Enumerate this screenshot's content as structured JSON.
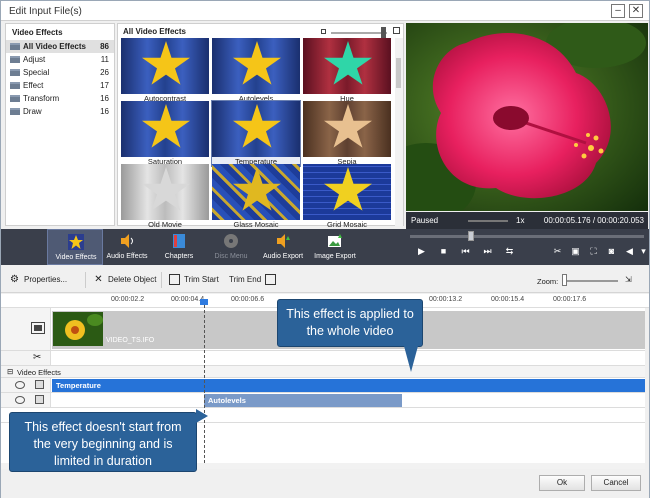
{
  "window": {
    "title": "Edit Input File(s)"
  },
  "categories": {
    "header": "Video Effects",
    "items": [
      {
        "label": "All Video Effects",
        "count": "86"
      },
      {
        "label": "Adjust",
        "count": "11"
      },
      {
        "label": "Special",
        "count": "26"
      },
      {
        "label": "Effect",
        "count": "17"
      },
      {
        "label": "Transform",
        "count": "16"
      },
      {
        "label": "Draw",
        "count": "16"
      }
    ]
  },
  "gallery": {
    "header": "All Video Effects",
    "tiles": [
      {
        "label": "Autocontrast",
        "star_color": "#f5c518",
        "bg": "blue"
      },
      {
        "label": "Autolevels",
        "star_color": "#f5c518",
        "bg": "blue"
      },
      {
        "label": "Hue",
        "star_color": "#2fd6a8",
        "bg": "red"
      },
      {
        "label": "Saturation",
        "star_color": "#f5c518",
        "bg": "blue"
      },
      {
        "label": "Temperature",
        "star_color": "#f5c518",
        "bg": "blue"
      },
      {
        "label": "Sepia",
        "star_color": "#e8c090",
        "bg": "brown"
      },
      {
        "label": "Old Movie",
        "star_color": "#d8d8d8",
        "bg": "gray"
      },
      {
        "label": "Glass Mosaic",
        "star_color": "#e0b820",
        "bg": "tile"
      },
      {
        "label": "Grid Mosaic",
        "star_color": "#f0d020",
        "bg": "grid"
      }
    ]
  },
  "preview_status": {
    "state": "Paused",
    "speed": "1x",
    "time": "00:00:05.176 / 00:00:20.053"
  },
  "tools": [
    {
      "label": "Video Effects",
      "icon": "star-icon"
    },
    {
      "label": "Audio Effects",
      "icon": "speaker-icon"
    },
    {
      "label": "Chapters",
      "icon": "film-icon"
    },
    {
      "label": "Disc Menu",
      "icon": "disc-icon"
    },
    {
      "label": "Audio Export",
      "icon": "audio-export-icon"
    },
    {
      "label": "Image Export",
      "icon": "image-export-icon"
    }
  ],
  "edit_toolbar": {
    "properties": "Properties...",
    "delete": "Delete Object",
    "trim_start": "Trim Start",
    "trim_end": "Trim End",
    "zoom": "Zoom:"
  },
  "ruler": [
    "00:00:02.2",
    "00:00:04.4",
    "00:00:06.6",
    "00:00:13.2",
    "00:00:15.4",
    "00:00:17.6"
  ],
  "timeline": {
    "video_clip": "VIDEO_TS.IFO",
    "group_label": "Video Effects",
    "effects": [
      "Temperature",
      "Autolevels"
    ]
  },
  "callouts": {
    "whole": "This effect is applied to the whole video",
    "partial": "This effect doesn't start from the very beginning and is limited in duration"
  },
  "footer": {
    "ok": "Ok",
    "cancel": "Cancel"
  },
  "colors": {
    "accent": "#2e7be0",
    "callout": "#2b6299",
    "toolbar": "#3a3f4b"
  }
}
